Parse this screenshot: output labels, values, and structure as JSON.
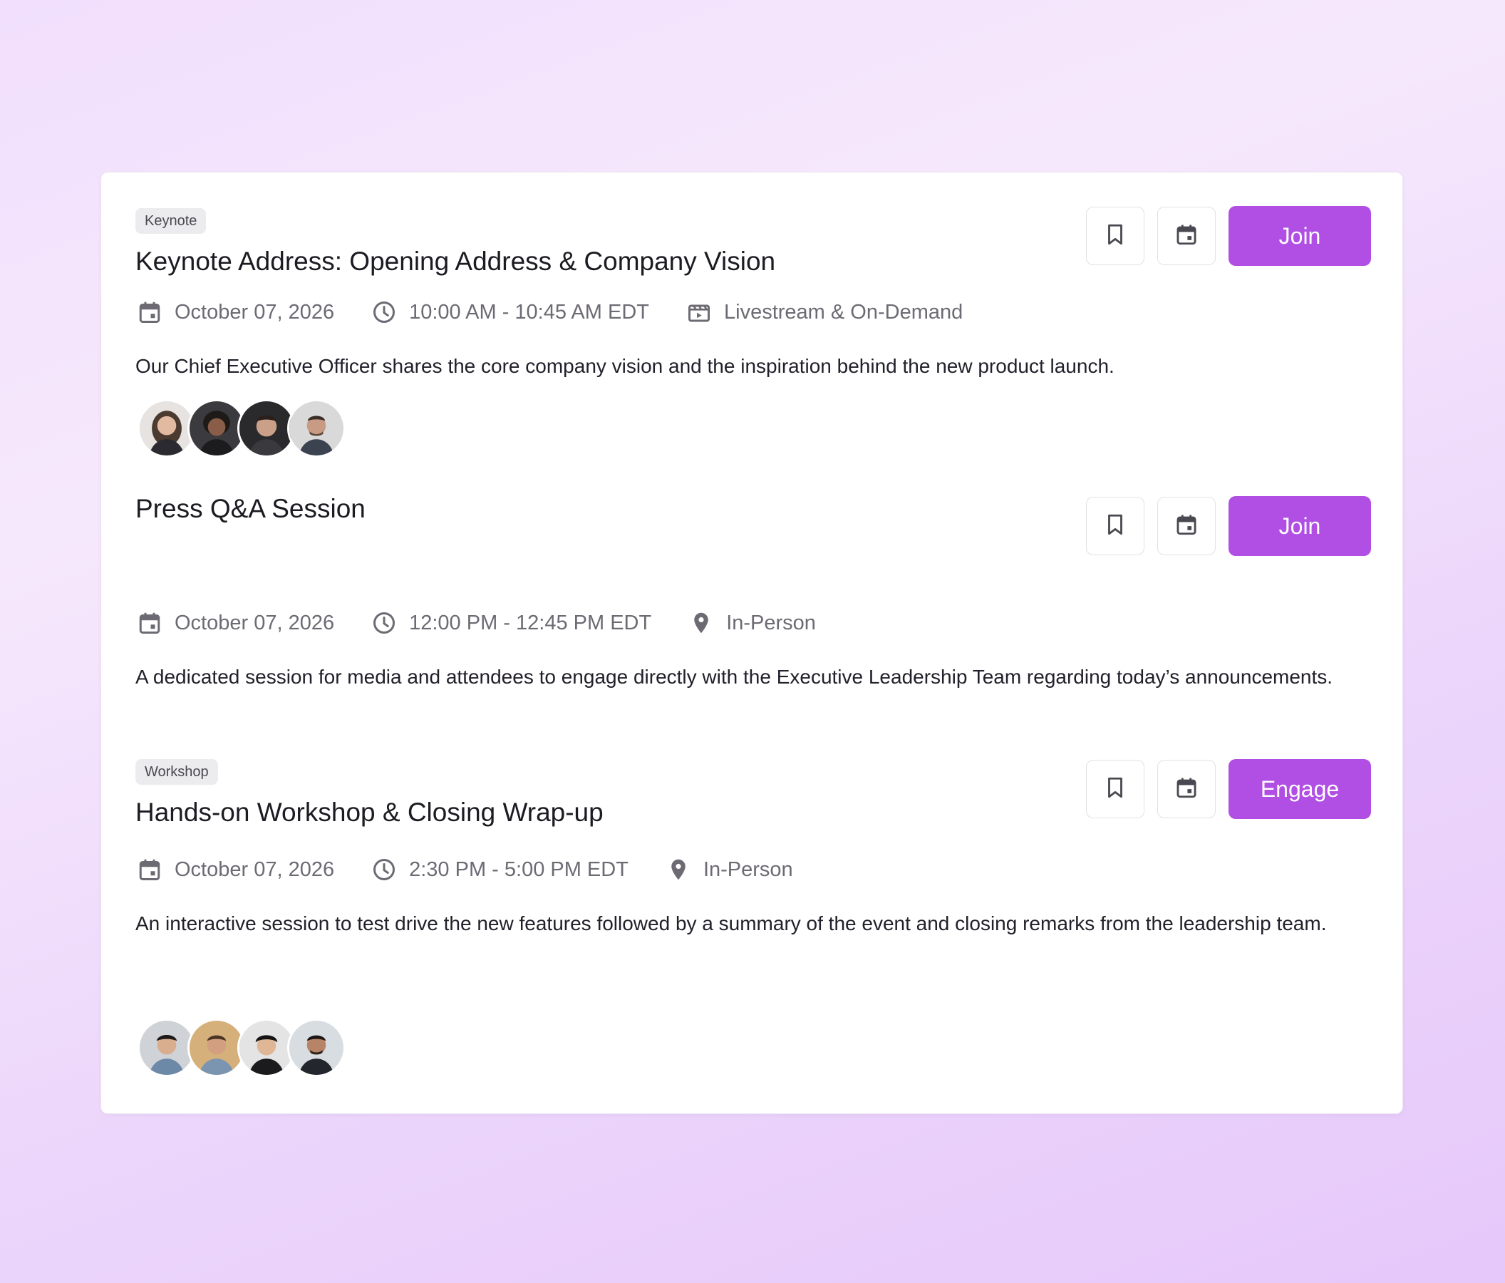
{
  "colors": {
    "accent": "#b14fe4",
    "tag_bg": "#ececef",
    "meta_text": "#6d6a73"
  },
  "sessions": [
    {
      "tag": "Keynote",
      "title": "Keynote Address: Opening Address & Company Vision",
      "date": "October 07, 2026",
      "time": "10:00 AM - 10:45 AM EDT",
      "location": "Livestream & On-Demand",
      "location_icon": "livestream-icon",
      "description": "Our Chief Executive Officer shares the core company vision and the inspiration behind the new product launch.",
      "action_label": "Join",
      "speakers": [
        "speaker-1",
        "speaker-2",
        "speaker-3",
        "speaker-4"
      ]
    },
    {
      "tag": "",
      "title": "Press Q&A Session",
      "date": "October 07, 2026",
      "time": "12:00 PM - 12:45 PM EDT",
      "location": "In-Person",
      "location_icon": "location-pin-icon",
      "description": "A dedicated session for media and attendees to engage directly with the Executive Leadership Team regarding today’s announcements.",
      "action_label": "Join",
      "speakers": []
    },
    {
      "tag": "Workshop",
      "title": "Hands-on Workshop & Closing Wrap-up",
      "date": "October 07, 2026",
      "time": "2:30 PM - 5:00 PM EDT",
      "location": "In-Person",
      "location_icon": "location-pin-icon",
      "description": "An interactive session to test drive the new features followed by a summary of the event and closing remarks from the leadership team.",
      "action_label": "Engage",
      "speakers": [
        "speaker-5",
        "speaker-6",
        "speaker-7",
        "speaker-8"
      ]
    }
  ]
}
